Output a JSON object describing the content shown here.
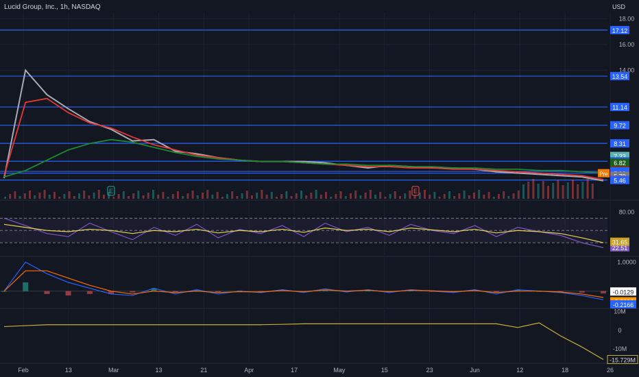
{
  "header": {
    "title": "Lucid Group, Inc., 1h, NASDAQ",
    "currency": "USD"
  },
  "colors": {
    "bg": "#131722",
    "grid": "#1e2230",
    "hline": "#2962ff",
    "ma_green": "#1b8a33",
    "ma_red": "#e53935",
    "ma_gray": "#a8abb3",
    "candle_up": "#26a69a",
    "candle_down": "#ef5350",
    "rsi": "#7e57c2",
    "rsi_ma": "#e8d44d",
    "macd": "#2962ff",
    "signal": "#ff6d00",
    "cum": "#c9b037"
  },
  "chart_data": {
    "type": "line",
    "price_axis": {
      "ticks": [
        "18.00",
        "16.00",
        "14.00"
      ],
      "levels": [
        {
          "label": "17.12",
          "color": "#2962ff",
          "line": true
        },
        {
          "label": "13.54",
          "color": "#2962ff",
          "line": true
        },
        {
          "label": "11.14",
          "color": "#2962ff",
          "line": true
        },
        {
          "label": "9.72",
          "color": "#2962ff",
          "line": true
        },
        {
          "label": "8.31",
          "color": "#2962ff",
          "line": true
        },
        {
          "label": "7.33",
          "color": "#5fb3b3",
          "line": false
        },
        {
          "label": "6.92",
          "color": "#2962ff",
          "line": true
        },
        {
          "label": "6.82",
          "color": "#1b5e20",
          "line": false
        },
        {
          "label": "6.19",
          "color": "#b71c1c",
          "line": false
        },
        {
          "label": "6.13",
          "color": "#2962ff",
          "line": true
        },
        {
          "label": "5.99",
          "color": "#2962ff",
          "line": true
        },
        {
          "label": "5.79",
          "color": "#787b86",
          "line": false
        },
        {
          "label": "5.48",
          "color": "#e53935",
          "line": false
        },
        {
          "label": "5.46",
          "color": "#2962ff",
          "line": true
        }
      ],
      "pre_badge": "Pre"
    },
    "x_ticks": [
      "Feb",
      "13",
      "Mar",
      "13",
      "21",
      "Apr",
      "17",
      "May",
      "15",
      "23",
      "Jun",
      "12",
      "18",
      "26"
    ],
    "earnings_markers": [
      "E",
      "E"
    ],
    "series": [
      {
        "values": [
          5.6,
          14.0,
          12.1,
          11.0,
          10.0,
          9.4,
          8.5,
          8.6,
          7.7,
          7.5,
          7.2,
          7.0,
          6.9,
          6.9,
          6.9,
          6.8,
          6.6,
          6.4,
          6.6,
          6.5,
          6.4,
          6.4,
          6.3,
          6.1,
          6.0,
          5.9,
          5.8,
          5.7,
          5.4
        ]
      },
      {
        "values": [
          5.8,
          11.5,
          11.8,
          10.7,
          9.9,
          9.5,
          8.8,
          8.2,
          7.8,
          7.4,
          7.2,
          7.0,
          6.9,
          6.9,
          6.8,
          6.7,
          6.6,
          6.5,
          6.5,
          6.4,
          6.4,
          6.3,
          6.3,
          6.2,
          6.1,
          6.0,
          5.9,
          5.8,
          5.5
        ]
      },
      {
        "values": [
          5.7,
          6.2,
          7.0,
          7.8,
          8.3,
          8.6,
          8.4,
          8.0,
          7.6,
          7.3,
          7.1,
          7.0,
          6.9,
          6.9,
          6.8,
          6.7,
          6.7,
          6.6,
          6.6,
          6.5,
          6.5,
          6.4,
          6.4,
          6.3,
          6.3,
          6.2,
          6.2,
          6.1,
          6.0
        ]
      }
    ],
    "rsi": {
      "ticks": [
        "80.00"
      ],
      "values": [
        70,
        58,
        45,
        40,
        62,
        48,
        35,
        55,
        42,
        60,
        38,
        52,
        45,
        58,
        40,
        62,
        48,
        55,
        42,
        60,
        50,
        45,
        58,
        40,
        55,
        48,
        42,
        30,
        22
      ],
      "ma": [
        60,
        55,
        50,
        48,
        52,
        50,
        45,
        50,
        48,
        52,
        46,
        50,
        48,
        52,
        47,
        54,
        50,
        52,
        48,
        54,
        51,
        48,
        52,
        46,
        50,
        48,
        45,
        38,
        30
      ],
      "labels": [
        "22.51",
        "31.65"
      ]
    },
    "macd": {
      "ticks": [
        "1.0000"
      ],
      "macd": [
        0,
        1.0,
        0.6,
        0.3,
        0.1,
        -0.1,
        -0.15,
        0.1,
        -0.1,
        0.05,
        -0.1,
        0.0,
        -0.05,
        0.05,
        -0.05,
        0.08,
        -0.03,
        0.05,
        -0.05,
        0.05,
        0.0,
        -0.05,
        0.05,
        -0.1,
        0.05,
        0.0,
        -0.05,
        -0.15,
        -0.3
      ],
      "signal": [
        0,
        0.7,
        0.7,
        0.45,
        0.2,
        0.0,
        -0.1,
        0.0,
        -0.05,
        0.0,
        -0.05,
        -0.02,
        -0.03,
        0.02,
        -0.02,
        0.04,
        0.0,
        0.03,
        -0.02,
        0.03,
        0.01,
        -0.02,
        0.02,
        -0.05,
        0.0,
        0.0,
        -0.03,
        -0.1,
        -0.22
      ],
      "labels": [
        "-0.0129",
        "-0.3026",
        "-0.2166"
      ]
    },
    "cumulative": {
      "ticks": [
        "10M",
        "0",
        "-10M"
      ],
      "values": [
        2,
        2.5,
        3,
        3,
        3,
        3,
        3,
        3,
        3,
        3,
        3,
        3,
        3,
        3.2,
        3.5,
        3.5,
        3.5,
        3.5,
        3.5,
        3.5,
        3.5,
        3.5,
        3.5,
        3.5,
        1.5,
        4,
        -3,
        -9,
        -15.7
      ],
      "label": "-15.729M"
    }
  }
}
